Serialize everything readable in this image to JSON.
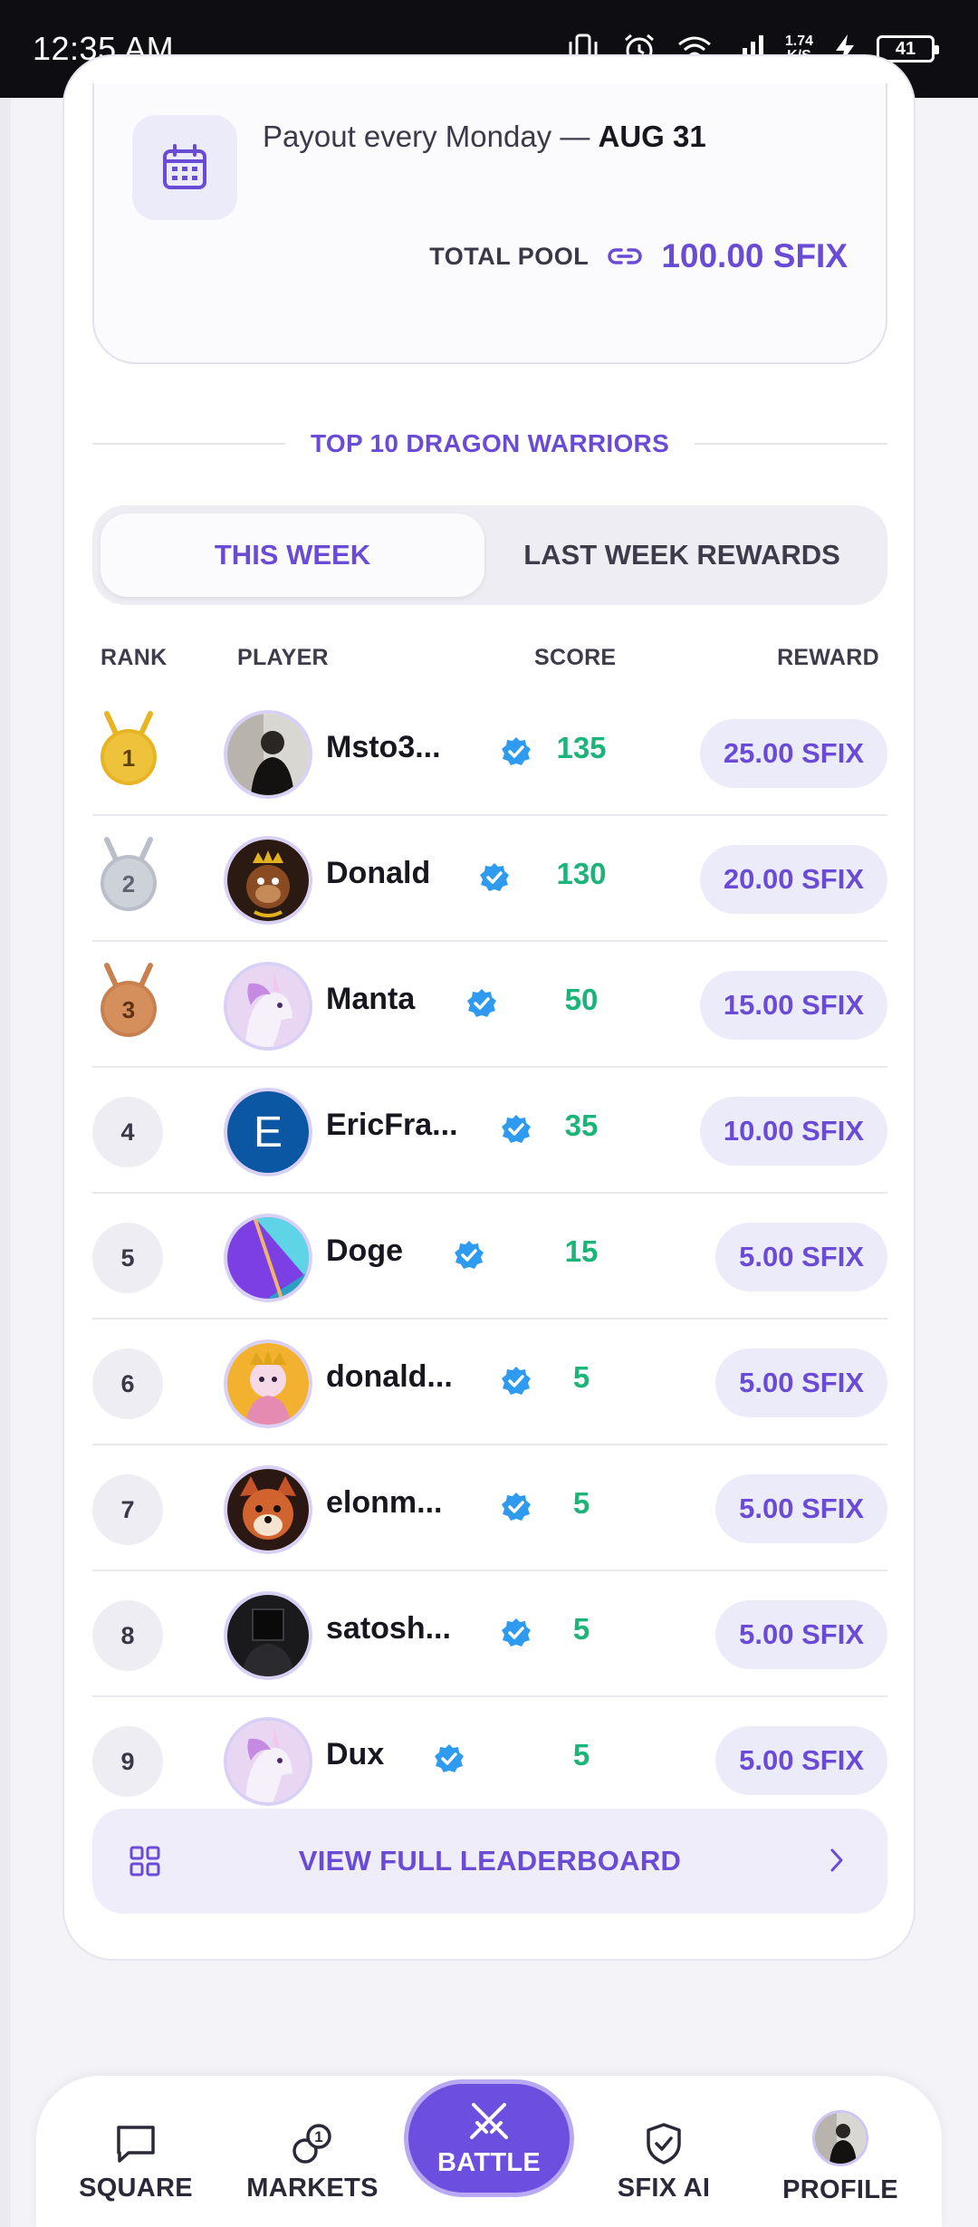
{
  "status_bar": {
    "time": "12:35 AM",
    "net_speed_value": "1.74",
    "net_speed_unit": "K/S",
    "battery": "41"
  },
  "payout": {
    "text": "Payout every Monday — ",
    "date": "AUG 31",
    "pool_label": "TOTAL POOL",
    "pool_value": "100.00 SFIX"
  },
  "leaderboard": {
    "title": "TOP 10 DRAGON WARRIORS",
    "tabs": [
      {
        "label": "THIS WEEK",
        "active": true
      },
      {
        "label": "LAST WEEK REWARDS",
        "active": false
      }
    ],
    "columns": {
      "rank": "RANK",
      "player": "PLAYER",
      "score": "SCORE",
      "reward": "REWARD"
    },
    "rows": [
      {
        "rank": "1",
        "name": "Msto3...",
        "score": "135",
        "reward": "25.00 SFIX"
      },
      {
        "rank": "2",
        "name": "Donald",
        "score": "130",
        "reward": "20.00 SFIX"
      },
      {
        "rank": "3",
        "name": "Manta",
        "score": "50",
        "reward": "15.00 SFIX"
      },
      {
        "rank": "4",
        "name": "EricFra...",
        "score": "35",
        "reward": "10.00 SFIX",
        "avatar_letter": "E"
      },
      {
        "rank": "5",
        "name": "Doge",
        "score": "15",
        "reward": "5.00 SFIX"
      },
      {
        "rank": "6",
        "name": "donald...",
        "score": "5",
        "reward": "5.00 SFIX"
      },
      {
        "rank": "7",
        "name": "elonm...",
        "score": "5",
        "reward": "5.00 SFIX"
      },
      {
        "rank": "8",
        "name": "satosh...",
        "score": "5",
        "reward": "5.00 SFIX"
      },
      {
        "rank": "9",
        "name": "Dux",
        "score": "5",
        "reward": "5.00 SFIX"
      }
    ],
    "view_full_label": "VIEW FULL LEADERBOARD"
  },
  "bottom_nav": {
    "square": "SQUARE",
    "markets": "MARKETS",
    "markets_badge": "1",
    "battle": "BATTLE",
    "sfix_ai": "SFIX AI",
    "profile": "PROFILE"
  },
  "colors": {
    "accent": "#6a4bd6",
    "score_green": "#1db47a",
    "verified_blue": "#2f9bf0",
    "gold": "#e7b423",
    "silver": "#b9bec8",
    "bronze": "#c7804e"
  }
}
